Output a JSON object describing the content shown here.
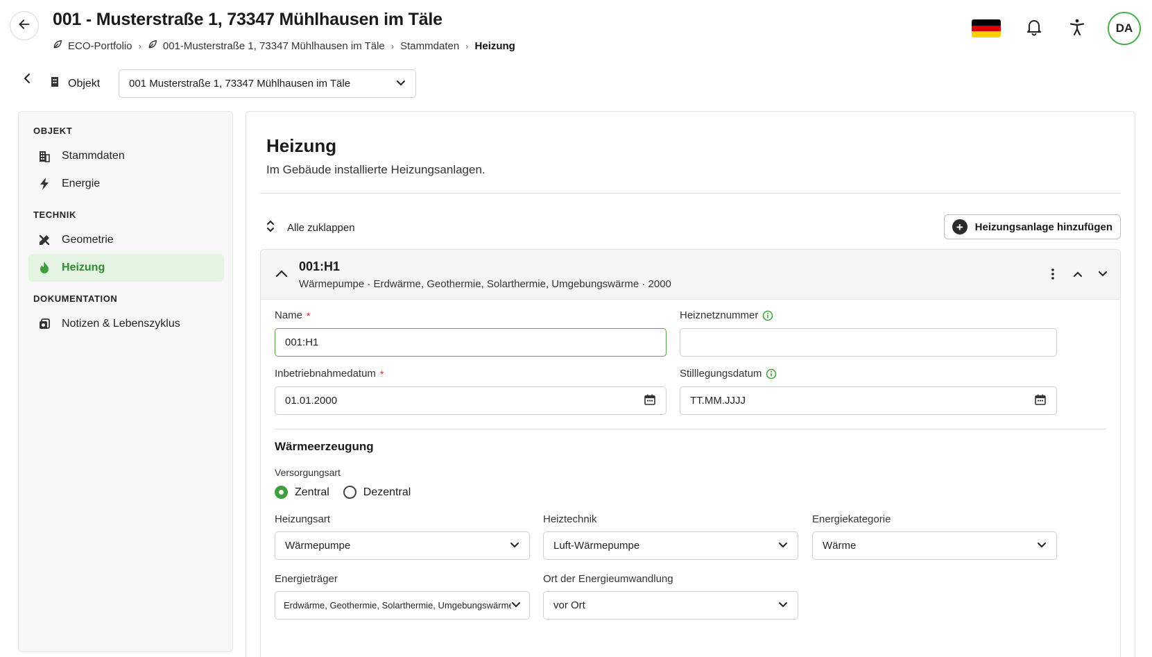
{
  "header": {
    "title": "001 - Musterstraße 1, 73347 Mühlhausen im Täle",
    "breadcrumb": [
      {
        "label": "ECO-Portfolio"
      },
      {
        "label": "001-Musterstraße 1, 73347 Mühlhausen im Täle"
      },
      {
        "label": "Stammdaten"
      },
      {
        "label": "Heizung"
      }
    ],
    "user_initials": "DA",
    "flag_colors": [
      "#000000",
      "#dd0000",
      "#ffce00"
    ],
    "icons": [
      "arrow-left-icon",
      "flag-germany-icon",
      "bell-icon",
      "accessibility-icon"
    ]
  },
  "object_bar": {
    "label": "Objekt",
    "selected": "001 Musterstraße 1, 73347 Mühlhausen im Täle"
  },
  "sidebar": {
    "sections": [
      {
        "title": "OBJEKT",
        "items": [
          {
            "label": "Stammdaten",
            "icon": "building-icon"
          },
          {
            "label": "Energie",
            "icon": "lightning-icon"
          }
        ]
      },
      {
        "title": "TECHNIK",
        "items": [
          {
            "label": "Geometrie",
            "icon": "ruler-pencil-icon"
          },
          {
            "label": "Heizung",
            "icon": "flame-icon",
            "active": true
          }
        ]
      },
      {
        "title": "DOKUMENTATION",
        "items": [
          {
            "label": "Notizen & Lebenszyklus",
            "icon": "notes-icon"
          }
        ]
      }
    ]
  },
  "main": {
    "title": "Heizung",
    "subtitle": "Im Gebäude installierte Heizungsanlagen.",
    "collapse_all": "Alle zuklappen",
    "add_button": "Heizungsanlage hinzufügen",
    "accent": "#3f9f3f"
  },
  "unit": {
    "title": "001:H1",
    "description": "Wärmepumpe · Erdwärme, Geothermie, Solarthermie, Umgebungswärme · 2000",
    "fields": {
      "name": {
        "label": "Name",
        "value": "001:H1",
        "required": "*"
      },
      "heiznetz": {
        "label": "Heiznetznummer",
        "value": ""
      },
      "inbetrieb": {
        "label": "Inbetriebnahmedatum",
        "value": "01.01.2000",
        "required": "*"
      },
      "stilllegung": {
        "label": "Stilllegungsdatum",
        "placeholder": "TT.MM.JJJJ"
      }
    },
    "waermeerzeugung": {
      "title": "Wärmeerzeugung",
      "versorgungsart": {
        "label": "Versorgungsart",
        "options": [
          "Zentral",
          "Dezentral"
        ],
        "selected": "Zentral"
      },
      "heizungsart": {
        "label": "Heizungsart",
        "value": "Wärmepumpe"
      },
      "heiztechnik": {
        "label": "Heiztechnik",
        "value": "Luft-Wärmepumpe"
      },
      "energiekategorie": {
        "label": "Energiekategorie",
        "value": "Wärme"
      },
      "energietraeger": {
        "label": "Energieträger",
        "value": "Erdwärme, Geothermie, Solarthermie, Umgebungswärme"
      },
      "ort": {
        "label": "Ort der Energieumwandlung",
        "value": "vor Ort"
      }
    }
  }
}
